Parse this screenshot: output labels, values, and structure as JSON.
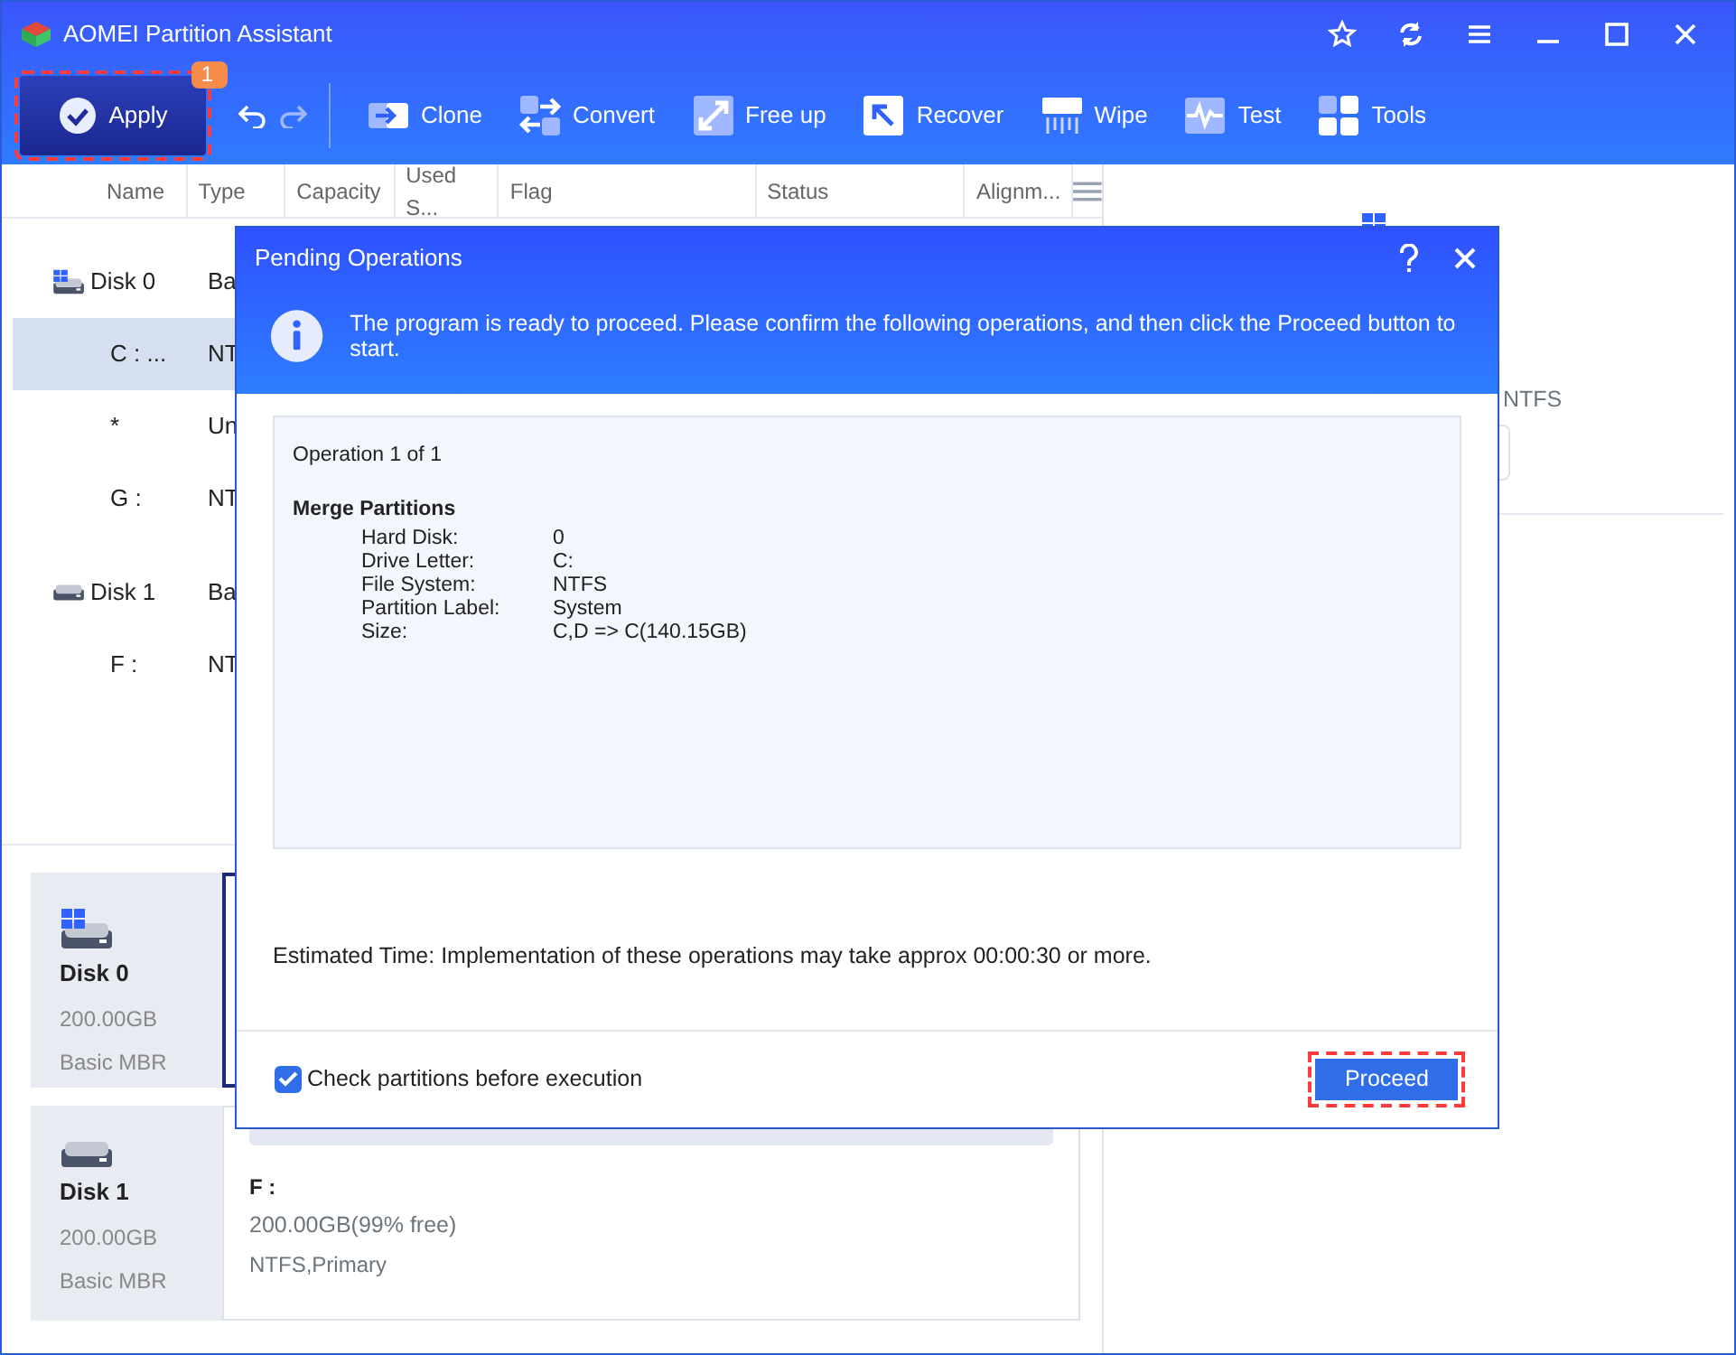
{
  "window": {
    "title": "AOMEI Partition Assistant"
  },
  "title_buttons": [
    {
      "kind": "star"
    },
    {
      "kind": "refresh"
    },
    {
      "kind": "menu"
    },
    {
      "kind": "minimize"
    },
    {
      "kind": "maximize"
    },
    {
      "kind": "close"
    }
  ],
  "toolbar": {
    "apply": {
      "label": "Apply",
      "badge": "1"
    },
    "tools": [
      {
        "label": "Clone",
        "kind": "clone"
      },
      {
        "label": "Convert",
        "kind": "convert"
      },
      {
        "label": "Free up",
        "kind": "freeup"
      },
      {
        "label": "Recover",
        "kind": "recover"
      },
      {
        "label": "Wipe",
        "kind": "wipe"
      },
      {
        "label": "Test",
        "kind": "test"
      },
      {
        "label": "Tools",
        "kind": "tools"
      }
    ]
  },
  "partition_table": {
    "columns": [
      "Name",
      "Type",
      "Capacity",
      "Used S...",
      "Flag",
      "Status",
      "Alignm..."
    ],
    "rows": [
      {
        "kind": "disk",
        "name": "Disk 0",
        "type": "Ba",
        "selected": false,
        "system": true
      },
      {
        "kind": "partition",
        "name": "C : ...",
        "type": "NT",
        "selected": true
      },
      {
        "kind": "partition",
        "name": "*",
        "type": "Un",
        "selected": false
      },
      {
        "kind": "partition",
        "name": "G :",
        "type": "NT",
        "selected": false
      },
      {
        "kind": "disk",
        "name": "Disk 1",
        "type": "Ba",
        "selected": false,
        "system": false
      },
      {
        "kind": "partition",
        "name": "F :",
        "type": "NT",
        "selected": false
      }
    ]
  },
  "disk_cards": [
    {
      "name": "Disk 0",
      "size": "200.00GB",
      "style": "Basic MBR",
      "system": true,
      "selected": true
    },
    {
      "name": "Disk 1",
      "size": "200.00GB",
      "style": "Basic MBR",
      "system": false,
      "selected": false,
      "partition": {
        "letter": "F :",
        "capacity": "200.00GB(99% free)",
        "details": "NTFS,Primary"
      }
    }
  ],
  "details_panel": {
    "file_system": "NTFS"
  },
  "dialog": {
    "title": "Pending Operations",
    "message": "The program is ready to proceed. Please confirm the following operations, and then click the Proceed button to start.",
    "counter": "Operation 1 of 1",
    "operation": {
      "name": "Merge Partitions",
      "fields": [
        {
          "label": "Hard Disk:",
          "value": "0"
        },
        {
          "label": "Drive Letter:",
          "value": "C:"
        },
        {
          "label": "File System:",
          "value": "NTFS"
        },
        {
          "label": "Partition Label:",
          "value": "System"
        },
        {
          "label": "Size:",
          "value": "C,D => C(140.15GB)"
        }
      ]
    },
    "estimate": "Estimated Time: Implementation of these operations may take approx 00:00:30 or more.",
    "checkbox": {
      "label": "Check partitions before execution",
      "checked": true
    },
    "proceed": "Proceed"
  }
}
